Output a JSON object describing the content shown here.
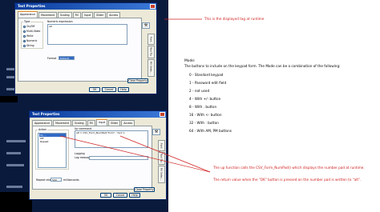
{
  "dialog1": {
    "title": "Text Properties",
    "tabs": [
      "Appearance",
      "Movement",
      "Scaling",
      "Fill",
      "Input",
      "Slider",
      "Access"
    ],
    "type_group": {
      "label": "Type",
      "options": [
        "On/Off",
        "Multi-State",
        "Write",
        "Numeric",
        "String"
      ],
      "selected": "Numeric"
    },
    "expression_label": "Numeric expression",
    "expression_value": "alt",
    "format_label": "Format",
    "format_value": "Default",
    "side_tabs": [
      "Font",
      "Tool Tip",
      "Fill Selec..."
    ],
    "buttons": [
      "OK",
      "Cancel",
      "Help"
    ],
    "close_prop": "Close Property"
  },
  "dialog2": {
    "title": "Text Properties",
    "tabs": [
      "Appearance",
      "Movement",
      "Scaling",
      "Fill",
      "Input",
      "Slider",
      "Access"
    ],
    "action_label": "Action",
    "action_items": [
      "On ...",
      "Off",
      "Repeat"
    ],
    "command_label": "Up command",
    "command_value": "alt = CSV_Form_NumPad(\"form\", \"AL1\");",
    "logging_label": "Logging",
    "log_message_label": "Log message:",
    "repeat_label": "Repeat rate",
    "repeat_value": "500",
    "repeat_units": "milliseconds",
    "side_tabs": [
      "Font",
      "Tool Tip",
      "Fill Selec..."
    ],
    "buttons": [
      "OK",
      "Cancel",
      "Help"
    ],
    "close_prop": "Close Property"
  },
  "annotations": {
    "top": "This is the displayed tag at runtime",
    "bottom_1": "The up function calls the CSV_Form_NumPad() which displays the number pad at runtime.",
    "bottom_2": "The return value when the \"OK\" button is pressed on the number pad is written to \"alt\"."
  },
  "mode": {
    "title": "Mode:",
    "description": "The buttons to include on the keypad form. The Mode can be a combination of the following:",
    "items": [
      "0 - Standard keypad",
      "1 - Password edit field",
      "2 - not used",
      "4 - With +/- button",
      "8 - With . button",
      "16 - With <- button",
      "32 - With : button",
      "64 - With AM, PM buttons"
    ]
  },
  "colors": {
    "annotation": "#d02020",
    "hmi_background": "#0a1a3c",
    "titlebar": "#0a3c9c"
  }
}
